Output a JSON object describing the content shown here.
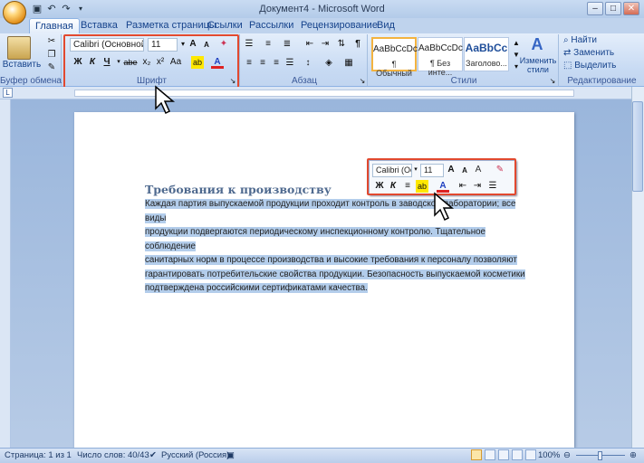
{
  "window": {
    "title": "Документ4 - Microsoft Word"
  },
  "tabs": [
    "Главная",
    "Вставка",
    "Разметка страницы",
    "Ссылки",
    "Рассылки",
    "Рецензирование",
    "Вид"
  ],
  "clipboard": {
    "paste_label": "Вставить",
    "group_label": "Буфер обмена"
  },
  "font": {
    "name": "Calibri (Основной те",
    "size": "11",
    "group_label": "Шрифт",
    "bold": "Ж",
    "italic": "К",
    "underline": "Ч",
    "strike": "abe",
    "sub": "x₂",
    "sup": "x²",
    "case": "Аа",
    "highlight": "ab",
    "color": "А",
    "grow": "A",
    "shrink": "A"
  },
  "paragraph": {
    "group_label": "Абзац"
  },
  "styles": {
    "group_label": "Стили",
    "items": [
      {
        "sample": "AaBbCcDc",
        "name": "¶ Обычный"
      },
      {
        "sample": "AaBbCcDc",
        "name": "¶ Без инте..."
      },
      {
        "sample": "AaBbCc",
        "name": "Заголово..."
      }
    ],
    "change_label": "Изменить стили"
  },
  "editing": {
    "group_label": "Редактирование",
    "find": "Найти",
    "replace": "Заменить",
    "select": "Выделить"
  },
  "mini_toolbar": {
    "font": "Calibri (Ос",
    "size": "11"
  },
  "document": {
    "heading": "Требования к производству",
    "paragraph": [
      "Каждая партия выпускаемой продукции проходит контроль в заводской лаборатории; все виды",
      "продукции подвергаются периодическому инспекционному контролю. Тщательное соблюдение",
      "санитарных норм в процессе производства и высокие требования к персоналу позволяют",
      "гарантировать потребительские свойства продукции. Безопасность выпускаемой косметики",
      "подтверждена российскими сертификатами качества."
    ]
  },
  "status": {
    "page": "Страница: 1 из 1",
    "words": "Число слов: 40/43",
    "language": "Русский (Россия)",
    "zoom": "100%"
  }
}
